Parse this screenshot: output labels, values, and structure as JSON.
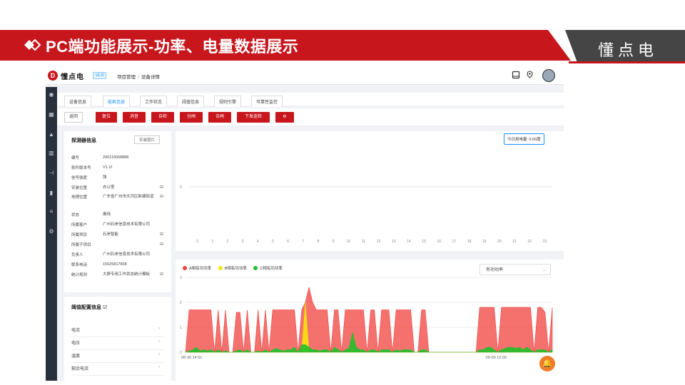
{
  "slide": {
    "title": "PC端功能展示-功率、电量数据展示",
    "brand": "懂点电",
    "accent_color": "#c8161d",
    "brand_box_color": "#454545"
  },
  "app": {
    "logo_mark": "D",
    "logo_text": "懂点电",
    "version": "v1.0",
    "breadcrumb": [
      "项目管理",
      "设备详情"
    ],
    "topbar_icons": [
      "book-icon",
      "map-pin-icon"
    ],
    "sidebar_icons": [
      "dashboard-icon",
      "grid-icon",
      "bell-icon",
      "building-icon",
      "wiring-icon",
      "file-icon",
      "document-icon",
      "settings-icon"
    ]
  },
  "tabs": [
    "设备信息",
    "能耗信息",
    "工作状态",
    "阈值信息",
    "规则引擎",
    "可靠性监控"
  ],
  "active_tab": 1,
  "toolbar": {
    "back": "返回",
    "buttons": [
      "复位",
      "消音",
      "自检",
      "分闸",
      "合闸",
      "下发巡检"
    ],
    "gear": "gear-icon"
  },
  "detector": {
    "title": "探测器信息",
    "install_photo": "安装图片",
    "rows": [
      {
        "k": "编号",
        "v": "290119068888",
        "icon": ""
      },
      {
        "k": "软件版本号",
        "v": "V1.1f",
        "icon": ""
      },
      {
        "k": "信号强度",
        "v": "强",
        "icon": ""
      },
      {
        "k": "安装位置",
        "v": "办公室",
        "icon": "⊟"
      },
      {
        "k": "地理位置",
        "v": "广东省广州市天河区新塘街道",
        "icon": "⊟"
      },
      {
        "k": "状态",
        "v": "离线",
        "icon": ""
      },
      {
        "k": "所属客户",
        "v": "广州石岸信息技术有限公司",
        "icon": ""
      },
      {
        "k": "所属项目",
        "v": "石岸智能",
        "icon": "⊟"
      },
      {
        "k": "所属子项目",
        "v": "",
        "icon": "⊟"
      },
      {
        "k": "负责人",
        "v": "广州石岸信息技术有限公司",
        "icon": ""
      },
      {
        "k": "联系电话",
        "v": "15625817838",
        "icon": ""
      },
      {
        "k": "统计规则",
        "v": "大屏专用工作状态统计模板",
        "icon": "⊟"
      }
    ]
  },
  "threshold": {
    "title": "阈值配置信息",
    "items": [
      "电流",
      "电压",
      "温度",
      "剩余电流"
    ]
  },
  "chart_data": [
    {
      "type": "bar",
      "title": "",
      "badge": "今日用电量: 0.00度",
      "categories": [
        "0",
        "1",
        "2",
        "3",
        "4",
        "5",
        "6",
        "7",
        "8",
        "9",
        "10",
        "11",
        "12",
        "13",
        "14",
        "15",
        "16",
        "17",
        "18",
        "19",
        "20",
        "21",
        "22",
        "23"
      ],
      "values": [
        0,
        0,
        0,
        0,
        0,
        0,
        0,
        0,
        0,
        0,
        0,
        0,
        0,
        0,
        0,
        0,
        0,
        0,
        0,
        0,
        0,
        0,
        0,
        0
      ],
      "yticks": [
        "0"
      ],
      "ylim": [
        0,
        1
      ],
      "grid": true
    },
    {
      "type": "area",
      "select_label": "有功功率",
      "series": [
        {
          "name": "A相有功功率",
          "color": "#f0413e",
          "values": [
            0,
            1.7,
            1.7,
            1.7,
            1.7,
            1.7,
            1.7,
            1.7,
            0,
            1.7,
            0,
            1.7,
            0,
            0,
            1.6,
            1.6,
            0,
            1.7,
            0,
            0,
            1.7,
            0,
            1.7,
            0,
            1.7,
            1.7,
            1.7,
            1.7,
            1.7,
            1.7,
            1.7,
            0,
            1.7,
            2.0,
            2.6,
            2.0,
            1.7,
            1.7,
            1.7,
            1.7,
            0,
            1.7,
            1.7,
            0,
            1.7,
            1.7,
            1.7,
            1.7,
            1.7,
            1.7,
            0,
            1.7,
            1.7,
            0,
            1.7,
            1.7,
            1.7,
            0,
            1.7,
            1.7,
            1.7,
            1.7,
            1.7,
            0,
            0,
            1.7,
            1.7,
            0,
            0,
            0,
            0,
            0,
            0,
            0,
            0,
            0,
            0,
            0,
            0,
            0,
            0,
            1.8,
            1.8,
            1.8,
            1.8,
            1.8,
            0,
            1.8,
            1.8,
            1.8,
            1.8,
            1.8,
            1.8,
            1.8,
            1.8,
            1.8,
            0,
            1.8,
            1.8,
            1.6,
            0,
            1.8
          ]
        },
        {
          "name": "B相有功功率",
          "color": "#f5e60c",
          "values": [
            0,
            0,
            0,
            0,
            0,
            0,
            0,
            0,
            0,
            0,
            0,
            0,
            0,
            0,
            0,
            0,
            0,
            0,
            0,
            0,
            0,
            0,
            0,
            0,
            0,
            0,
            0,
            0,
            0,
            0,
            0,
            0,
            0,
            2.0,
            0,
            0,
            0,
            0,
            0,
            0,
            0,
            0,
            0,
            0,
            0,
            0,
            0,
            0,
            0,
            0,
            0,
            0,
            0,
            0,
            0,
            0,
            0,
            0,
            0,
            0,
            0,
            0,
            0,
            0,
            0,
            0,
            0,
            0,
            0,
            0,
            0,
            0,
            0,
            0,
            0,
            0,
            0,
            0,
            0,
            0,
            0,
            0,
            0,
            0,
            0,
            0,
            0,
            0,
            0,
            0,
            0,
            0,
            0,
            0,
            0,
            0,
            0,
            0,
            0,
            0,
            0
          ]
        },
        {
          "name": "C相有功功率",
          "color": "#22c02a",
          "values": [
            0,
            0.05,
            0.1,
            0.2,
            0.05,
            0.1,
            0.05,
            0.1,
            0,
            0.1,
            0,
            0.05,
            0,
            0,
            0.05,
            0.1,
            0,
            0.1,
            0,
            0,
            0.05,
            0,
            0.1,
            0,
            0.1,
            0.15,
            0.1,
            0.05,
            0.1,
            0.1,
            0.2,
            0,
            0.3,
            0.3,
            0.2,
            0.1,
            0.1,
            0.05,
            0.1,
            0.1,
            0,
            0.2,
            0.1,
            0,
            0.1,
            0.15,
            0.8,
            0.2,
            0.1,
            0.1,
            0,
            0.1,
            0.1,
            0,
            0.1,
            0.1,
            0.1,
            0,
            0.1,
            0.05,
            0.1,
            0.1,
            0.1,
            0,
            0,
            0.1,
            0.1,
            0,
            0,
            0,
            0,
            0,
            0,
            0,
            0,
            0,
            0,
            0,
            0,
            0,
            0,
            0.1,
            0.1,
            0.2,
            0.2,
            0.1,
            0,
            0.1,
            0.15,
            0.2,
            0.2,
            0.15,
            0.2,
            0.1,
            0.2,
            0.1,
            0,
            0.1,
            0.1,
            0.1,
            0,
            0.1
          ]
        }
      ],
      "yticks": [
        "0",
        "1",
        "2",
        "3"
      ],
      "ylim": [
        0,
        3
      ],
      "x_labels": [
        "08-30 14:51",
        "09-09 12:00"
      ],
      "grid": true
    }
  ]
}
